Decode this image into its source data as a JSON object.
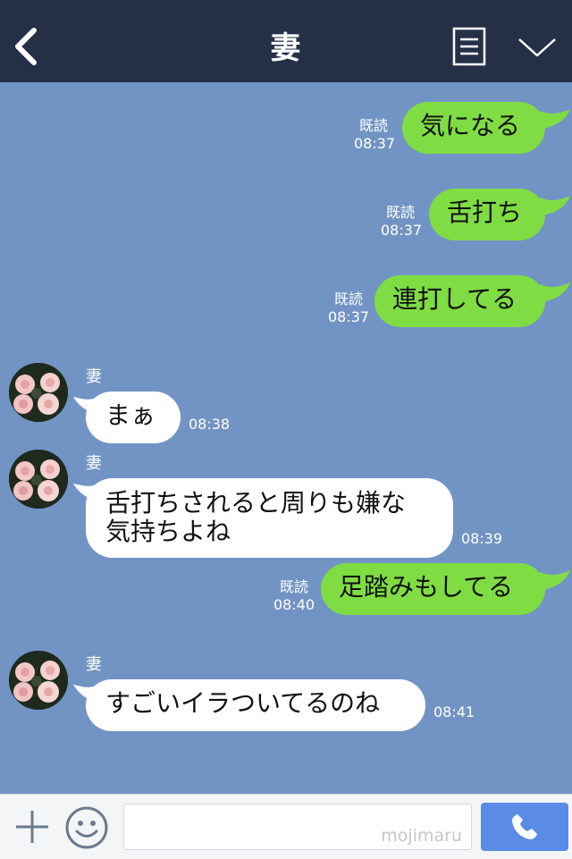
{
  "header": {
    "title": "妻"
  },
  "messages": [
    {
      "side": "sent",
      "status": "既読",
      "time": "08:37",
      "text": "気になる"
    },
    {
      "side": "sent",
      "status": "既読",
      "time": "08:37",
      "text": "舌打ち"
    },
    {
      "side": "sent",
      "status": "既読",
      "time": "08:37",
      "text": "連打してる"
    },
    {
      "side": "received",
      "sender": "妻",
      "time": "08:38",
      "text": "まぁ"
    },
    {
      "side": "received",
      "sender": "妻",
      "time": "08:39",
      "lines": [
        "舌打ちされると周りも嫌な",
        "気持ちよね"
      ]
    },
    {
      "side": "sent",
      "status": "既読",
      "time": "08:40",
      "text": "足踏みもしてる"
    },
    {
      "side": "received",
      "sender": "妻",
      "time": "08:41",
      "text": "すごいイラついてるのね"
    }
  ],
  "input": {
    "watermark": "mojimaru"
  },
  "icons": {
    "back": "chevron-left-icon",
    "notes": "notes-icon",
    "menu": "chevron-down-icon",
    "add": "plus-icon",
    "emoji": "smiley-icon",
    "call": "phone-icon"
  },
  "colors": {
    "header": "#253047",
    "background": "#7294c4",
    "sent_bubble": "#7fdc43",
    "received_bubble": "#ffffff",
    "call_button": "#5a8ce6"
  }
}
